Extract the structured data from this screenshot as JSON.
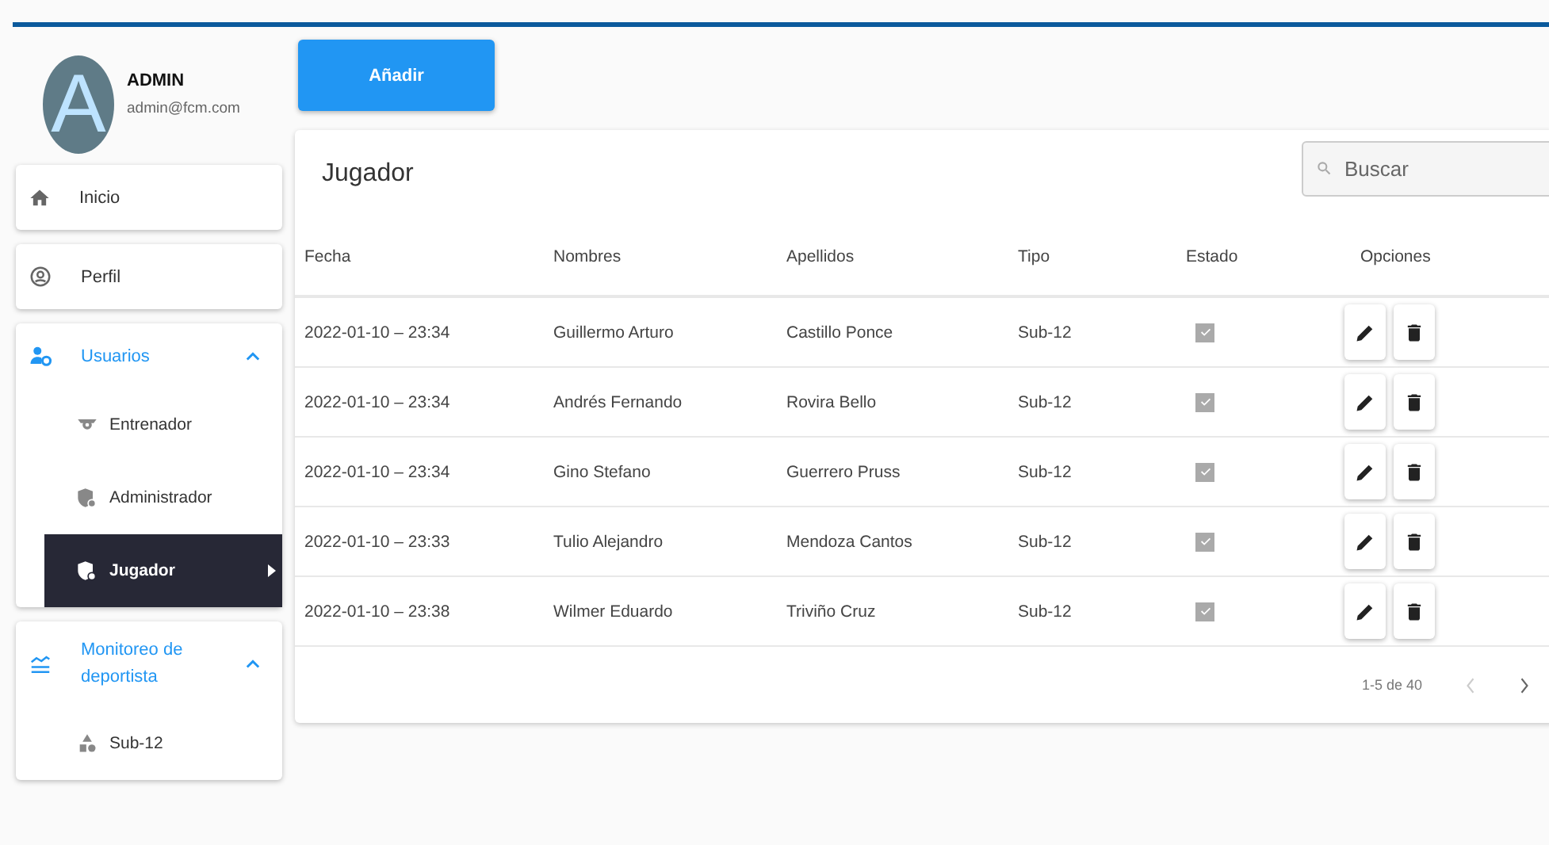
{
  "user": {
    "avatar_letter": "A",
    "name": "ADMIN",
    "email": "admin@fcm.com"
  },
  "sidebar": {
    "items": [
      {
        "kind": "link",
        "label": "Inicio"
      },
      {
        "kind": "link",
        "label": "Perfil"
      },
      {
        "kind": "group",
        "label": "Usuarios",
        "expanded": true,
        "children": [
          {
            "label": "Entrenador",
            "selected": false
          },
          {
            "label": "Administrador",
            "selected": false
          },
          {
            "label": "Jugador",
            "selected": true
          }
        ]
      },
      {
        "kind": "group",
        "label": "Monitoreo de deportista",
        "expanded": true,
        "children": [
          {
            "label": "Sub-12",
            "selected": false
          }
        ]
      }
    ]
  },
  "add_button": "Añadir",
  "table": {
    "title": "Jugador",
    "search": {
      "placeholder": "Buscar"
    },
    "columns": [
      "Fecha",
      "Nombres",
      "Apellidos",
      "Tipo",
      "Estado",
      "Opciones"
    ],
    "rows": [
      {
        "fecha": "2022-01-10 – 23:34",
        "nombres": "Guillermo Arturo",
        "apellidos": "Castillo Ponce",
        "tipo": "Sub-12",
        "checked": true
      },
      {
        "fecha": "2022-01-10 – 23:34",
        "nombres": "Andrés Fernando",
        "apellidos": "Rovira Bello",
        "tipo": "Sub-12",
        "checked": true
      },
      {
        "fecha": "2022-01-10 – 23:34",
        "nombres": "Gino Stefano",
        "apellidos": "Guerrero Pruss",
        "tipo": "Sub-12",
        "checked": true
      },
      {
        "fecha": "2022-01-10 – 23:33",
        "nombres": "Tulio Alejandro",
        "apellidos": "Mendoza Cantos",
        "tipo": "Sub-12",
        "checked": true
      },
      {
        "fecha": "2022-01-10 – 23:38",
        "nombres": "Wilmer Eduardo",
        "apellidos": "Triviño Cruz",
        "tipo": "Sub-12",
        "checked": true
      }
    ],
    "pagination": {
      "range": "1-5 de 40",
      "prev_disabled": true,
      "next_disabled": false
    }
  }
}
